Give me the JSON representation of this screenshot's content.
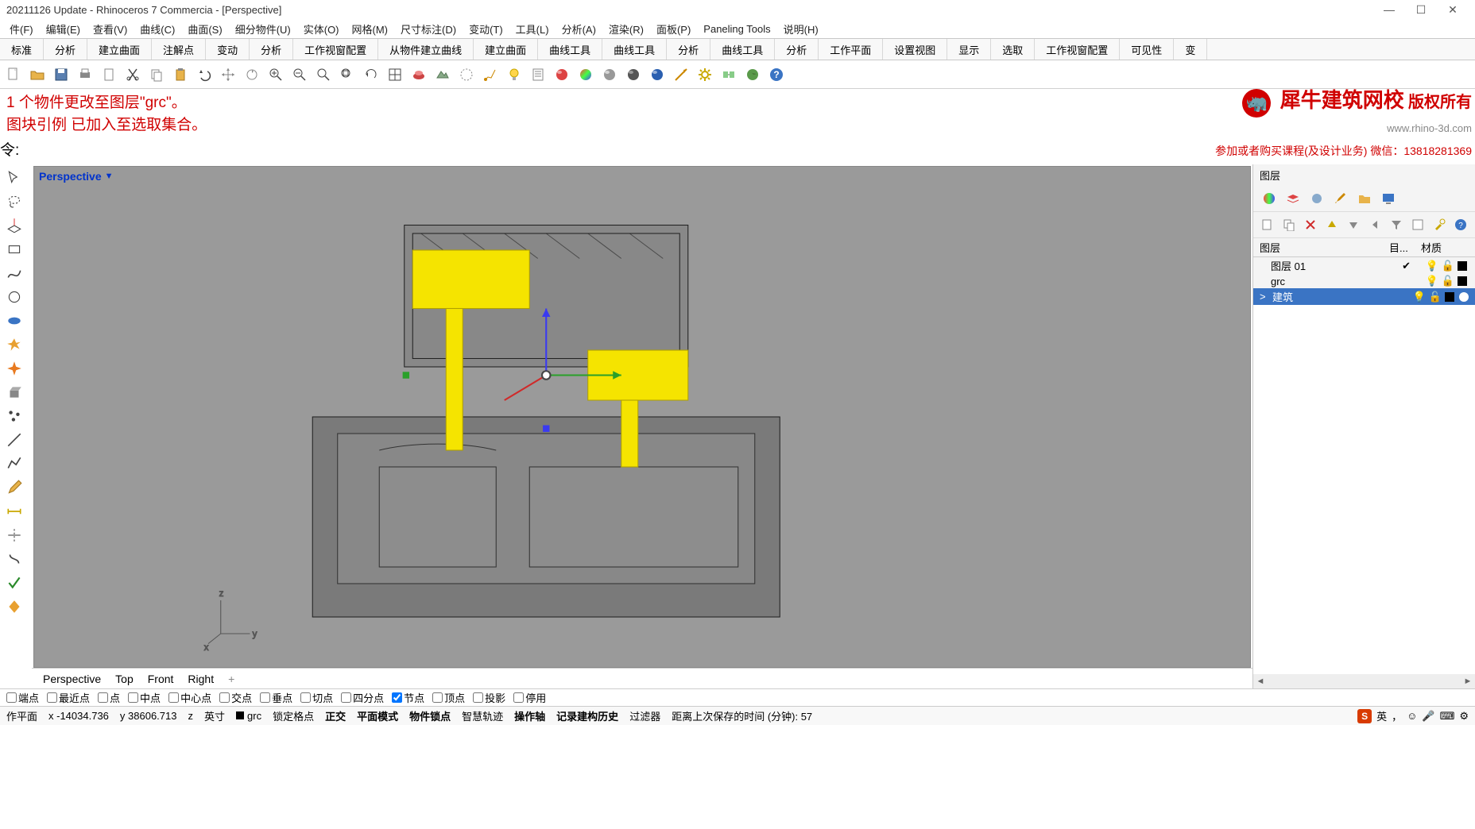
{
  "title": "20211126 Update - Rhinoceros 7 Commercia - [Perspective]",
  "menus": [
    "件(F)",
    "编辑(E)",
    "查看(V)",
    "曲线(C)",
    "曲面(S)",
    "细分物件(U)",
    "实体(O)",
    "网格(M)",
    "尺寸标注(D)",
    "变动(T)",
    "工具(L)",
    "分析(A)",
    "渲染(R)",
    "面板(P)",
    "Paneling Tools",
    "说明(H)"
  ],
  "tabs": [
    "标准",
    "分析",
    "建立曲面",
    "注解点",
    "变动",
    "分析",
    "工作视窗配置",
    "从物件建立曲线",
    "建立曲面",
    "曲线工具",
    "曲线工具",
    "分析",
    "曲线工具",
    "分析",
    "工作平面",
    "设置视图",
    "显示",
    "选取",
    "工作视窗配置",
    "可见性",
    "变"
  ],
  "cmdlog": {
    "line1": "1 个物件更改至图层\"grc\"。",
    "line2": "图块引例 已加入至选取集合。",
    "prompt": "令:"
  },
  "watermark": {
    "title": "犀牛建筑网校",
    "copyright": "版权所有",
    "url": "www.rhino-3d.com",
    "sub": "参加或者购买课程(及设计业务) 微信：13818281369"
  },
  "viewport": {
    "label": "Perspective"
  },
  "viewtabs": [
    "Perspective",
    "Top",
    "Front",
    "Right"
  ],
  "layers_panel": {
    "title": "图层",
    "headers": [
      "图层",
      "目...",
      "材质"
    ],
    "rows": [
      {
        "name": "图层 01",
        "current": true,
        "color": "#000",
        "expand": ""
      },
      {
        "name": "grc",
        "current": false,
        "color": "#000",
        "expand": ""
      },
      {
        "name": "建筑",
        "current": false,
        "color": "#000",
        "expand": ">",
        "sel": true
      }
    ]
  },
  "osnap": {
    "items": [
      {
        "label": "端点",
        "checked": false
      },
      {
        "label": "最近点",
        "checked": false
      },
      {
        "label": "点",
        "checked": false
      },
      {
        "label": "中点",
        "checked": false
      },
      {
        "label": "中心点",
        "checked": false
      },
      {
        "label": "交点",
        "checked": false
      },
      {
        "label": "垂点",
        "checked": false
      },
      {
        "label": "切点",
        "checked": false
      },
      {
        "label": "四分点",
        "checked": false
      },
      {
        "label": "节点",
        "checked": true
      },
      {
        "label": "顶点",
        "checked": false
      },
      {
        "label": "投影",
        "checked": false
      },
      {
        "label": "停用",
        "checked": false
      }
    ]
  },
  "status": {
    "plane": "作平面",
    "x": "x -14034.736",
    "y": "y 38606.713",
    "z": "z",
    "unit": "英寸",
    "layer": "grc",
    "items": [
      "锁定格点",
      "正交",
      "平面模式",
      "物件锁点",
      "智慧轨迹",
      "操作轴",
      "记录建构历史"
    ],
    "filter": "过滤器",
    "autosave": "距离上次保存的时间 (分钟): 57",
    "ime": "英"
  }
}
